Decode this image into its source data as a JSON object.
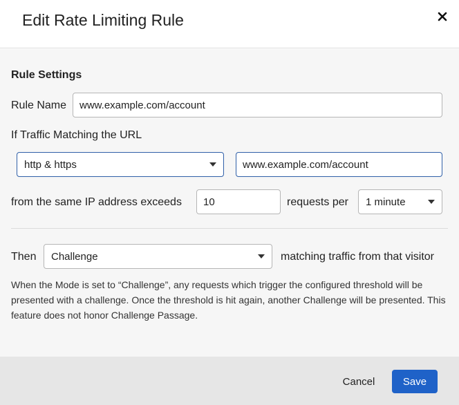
{
  "dialog": {
    "title": "Edit Rate Limiting Rule",
    "close_icon": "close-icon"
  },
  "rule_settings": {
    "section_title": "Rule Settings",
    "rule_name_label": "Rule Name",
    "rule_name_value": "www.example.com/account",
    "traffic_label": "If Traffic Matching the URL",
    "protocol_selected": "http & https",
    "url_value": "www.example.com/account",
    "ip_label": "from the same IP address exceeds",
    "requests_value": "10",
    "requests_per_label": "requests per",
    "period_selected": "1 minute"
  },
  "action": {
    "then_label": "Then",
    "mode_selected": "Challenge",
    "matching_label": "matching traffic from that visitor",
    "description": "When the Mode is set to “Challenge”, any requests which trigger the configured threshold will be presented with a challenge. Once the threshold is hit again, another Challenge will be presented. This feature does not honor Challenge Passage."
  },
  "footer": {
    "cancel_label": "Cancel",
    "save_label": "Save"
  },
  "colors": {
    "primary": "#1f62c8",
    "focus_border": "#2f5fa8",
    "footer_bg": "#e6e6e6",
    "body_bg": "#f6f6f6"
  }
}
